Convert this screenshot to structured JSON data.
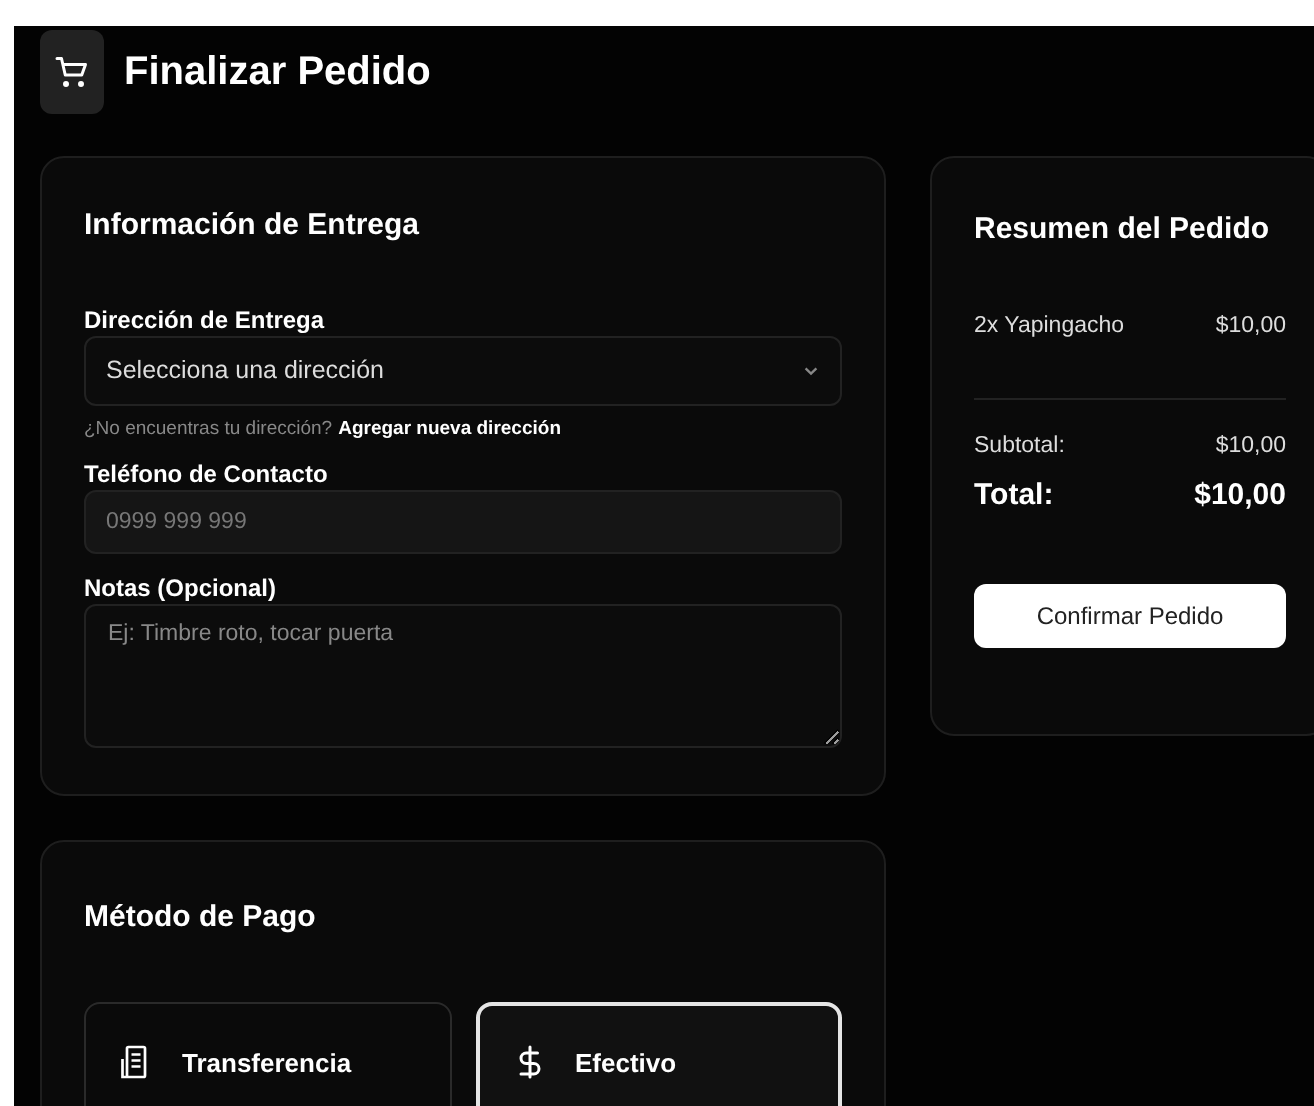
{
  "header": {
    "title": "Finalizar Pedido"
  },
  "delivery": {
    "title": "Información de Entrega",
    "address": {
      "label": "Dirección de Entrega",
      "value": "Selecciona una dirección",
      "hint": "¿No encuentras tu dirección?",
      "link": "Agregar nueva dirección"
    },
    "phone": {
      "label": "Teléfono de Contacto",
      "placeholder": "0999 999 999"
    },
    "notes": {
      "label": "Notas (Opcional)",
      "placeholder": "Ej: Timbre roto, tocar puerta"
    }
  },
  "payment": {
    "title": "Método de Pago",
    "options": [
      {
        "label": "Transferencia",
        "kind": "bank",
        "selected": false
      },
      {
        "label": "Efectivo",
        "kind": "cash",
        "selected": true
      }
    ]
  },
  "summary": {
    "title": "Resumen del Pedido",
    "items": [
      {
        "name": "2x Yapingacho",
        "price": "$10,00"
      }
    ],
    "subtotal_label": "Subtotal:",
    "subtotal": "$10,00",
    "total_label": "Total:",
    "total": "$10,00",
    "button": "Confirmar Pedido"
  }
}
